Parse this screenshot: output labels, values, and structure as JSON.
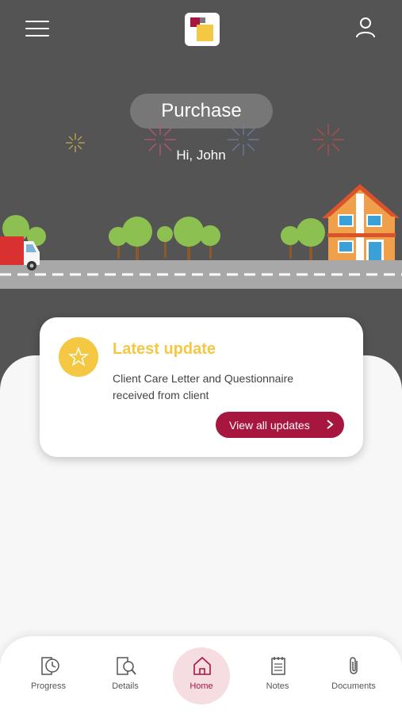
{
  "header": {
    "title": "Purchase",
    "greeting": "Hi, John"
  },
  "icons": {
    "menu": "hamburger-menu-icon",
    "logo": "app-logo",
    "profile": "user-profile-icon",
    "star": "star-icon",
    "chevron": "chevron-right-icon"
  },
  "update_card": {
    "title": "Latest update",
    "message": "Client Care Letter and Questionnaire received from client",
    "button_label": "View all updates"
  },
  "nav": {
    "items": [
      {
        "label": "Progress",
        "icon": "progress-clock-icon"
      },
      {
        "label": "Details",
        "icon": "details-search-icon"
      },
      {
        "label": "Home",
        "icon": "home-icon",
        "active": true
      },
      {
        "label": "Notes",
        "icon": "notes-icon"
      },
      {
        "label": "Documents",
        "icon": "paperclip-icon"
      }
    ]
  },
  "colors": {
    "hero_bg": "#545454",
    "accent": "#a6163e",
    "highlight": "#f4c842",
    "surface": "#f7f7f7"
  }
}
